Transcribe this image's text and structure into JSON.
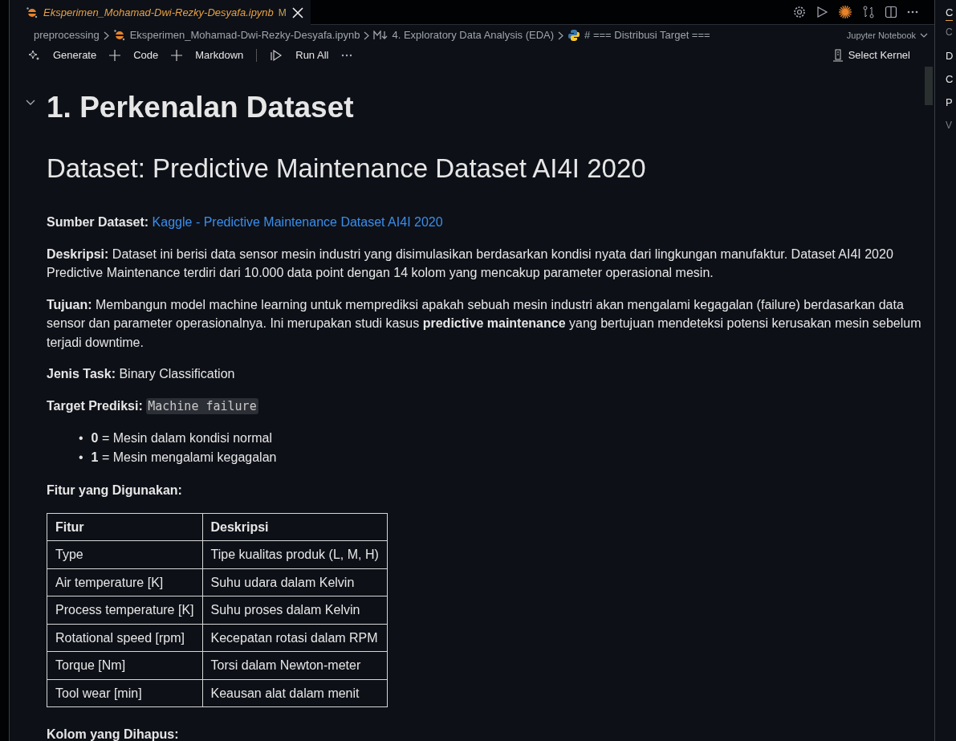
{
  "tab": {
    "title": "Eksperimen_Mohamad-Dwi-Rezky-Desyafa.ipynb",
    "badge": "M",
    "preview": true
  },
  "breadcrumbs": [
    {
      "kind": "folder",
      "text": "preprocessing"
    },
    {
      "kind": "notebook",
      "text": "Eksperimen_Mohamad-Dwi-Rezky-Desyafa.ipynb"
    },
    {
      "kind": "markdown",
      "text": "4. Exploratory Data Analysis (EDA)"
    },
    {
      "kind": "python",
      "text": "# === Distribusi Target ==="
    }
  ],
  "notebook_type": "Jupyter Notebook",
  "toolbar": [
    {
      "kind": "sparkle",
      "label": "Generate"
    },
    {
      "kind": "plus",
      "label": "Code"
    },
    {
      "kind": "plus",
      "label": "Markdown"
    },
    {
      "kind": "run",
      "label": "Run All"
    }
  ],
  "kernel": "Select Kernel",
  "cell": [
    {
      "kind": "h1",
      "text": "1. Perkenalan Dataset"
    },
    {
      "kind": "h2",
      "text": "Dataset: Predictive Maintenance Dataset AI4I 2020"
    },
    {
      "kind": "para",
      "parts": [
        {
          "kind": "text",
          "text": "**Sumber Dataset:** "
        },
        {
          "kind": "link",
          "text": "Kaggle - Predictive Maintenance Dataset AI4I 2020"
        }
      ]
    },
    {
      "kind": "para",
      "parts": [
        {
          "kind": "text",
          "text": "**Deskripsi:** Dataset ini berisi data sensor mesin industri yang disimulasikan berdasarkan kondisi nyata dari lingkungan manufaktur. Dataset AI4I 2020 Predictive Maintenance terdiri dari 10.000 data point dengan 14 kolom yang mencakup parameter operasional mesin."
        }
      ]
    },
    {
      "kind": "para",
      "parts": [
        {
          "kind": "text",
          "text": "**Tujuan:** Membangun model machine learning untuk memprediksi apakah sebuah mesin industri akan mengalami kegagalan (failure) berdasarkan data sensor dan parameter operasionalnya. Ini merupakan studi kasus **predictive maintenance** yang bertujuan mendeteksi potensi kerusakan mesin sebelum terjadi downtime."
        }
      ]
    },
    {
      "kind": "para",
      "parts": [
        {
          "kind": "text",
          "text": "**Jenis Task:** Binary Classification"
        }
      ]
    },
    {
      "kind": "para",
      "parts": [
        {
          "kind": "text",
          "text": "**Target Prediksi:** "
        },
        {
          "kind": "code",
          "text": "Machine failure"
        }
      ]
    },
    {
      "kind": "list",
      "items": [
        {
          "marker": "•",
          "text": "**0** = Mesin dalam kondisi normal"
        },
        {
          "marker": "•",
          "text": "**1** = Mesin mengalami kegagalan"
        }
      ]
    },
    {
      "kind": "para",
      "parts": [
        {
          "kind": "text",
          "text": "**Fitur yang Digunakan:**"
        }
      ]
    },
    {
      "kind": "table",
      "columns": [
        "Fitur",
        "Deskripsi"
      ],
      "rows": [
        [
          "Type",
          "Tipe kualitas produk (L, M, H)"
        ],
        [
          "Air temperature [K]",
          "Suhu udara dalam Kelvin"
        ],
        [
          "Process temperature [K]",
          "Suhu proses dalam Kelvin"
        ],
        [
          "Rotational speed [rpm]",
          "Kecepatan rotasi dalam RPM"
        ],
        [
          "Torque [Nm]",
          "Torsi dalam Newton-meter"
        ],
        [
          "Tool wear [min]",
          "Keausan alat dalam menit"
        ]
      ]
    },
    {
      "kind": "para",
      "parts": [
        {
          "kind": "text",
          "text": "**Kolom yang Dihapus:**"
        }
      ]
    }
  ],
  "side_panel": {
    "tabs": [
      {
        "text": "C",
        "selected": true
      }
    ],
    "items": [
      {
        "text": "C",
        "dim": true
      },
      {
        "text": "D",
        "dim": false
      },
      {
        "text": "C",
        "dim": false
      },
      {
        "text": "P",
        "dim": false
      },
      {
        "text": "V",
        "dim": true
      }
    ]
  }
}
